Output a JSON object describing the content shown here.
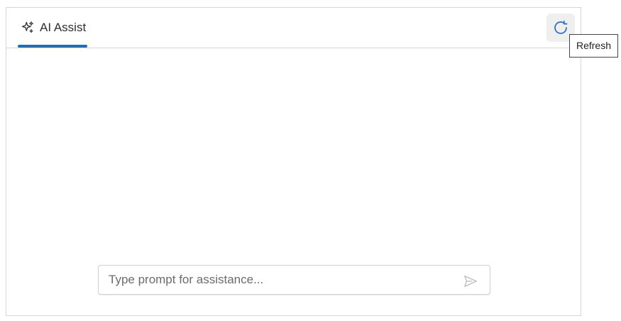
{
  "header": {
    "tabs": [
      {
        "label": "AI Assist",
        "icon": "sparkles-icon",
        "active": true
      }
    ],
    "refresh_button": {
      "icon": "refresh-icon",
      "tooltip": "Refresh"
    }
  },
  "prompt": {
    "placeholder": "Type prompt for assistance...",
    "value": "",
    "send_icon": "send-icon"
  },
  "colors": {
    "accent": "#1f6fb2",
    "border": "#d6d6d6",
    "refresh_bg": "#efefef"
  }
}
